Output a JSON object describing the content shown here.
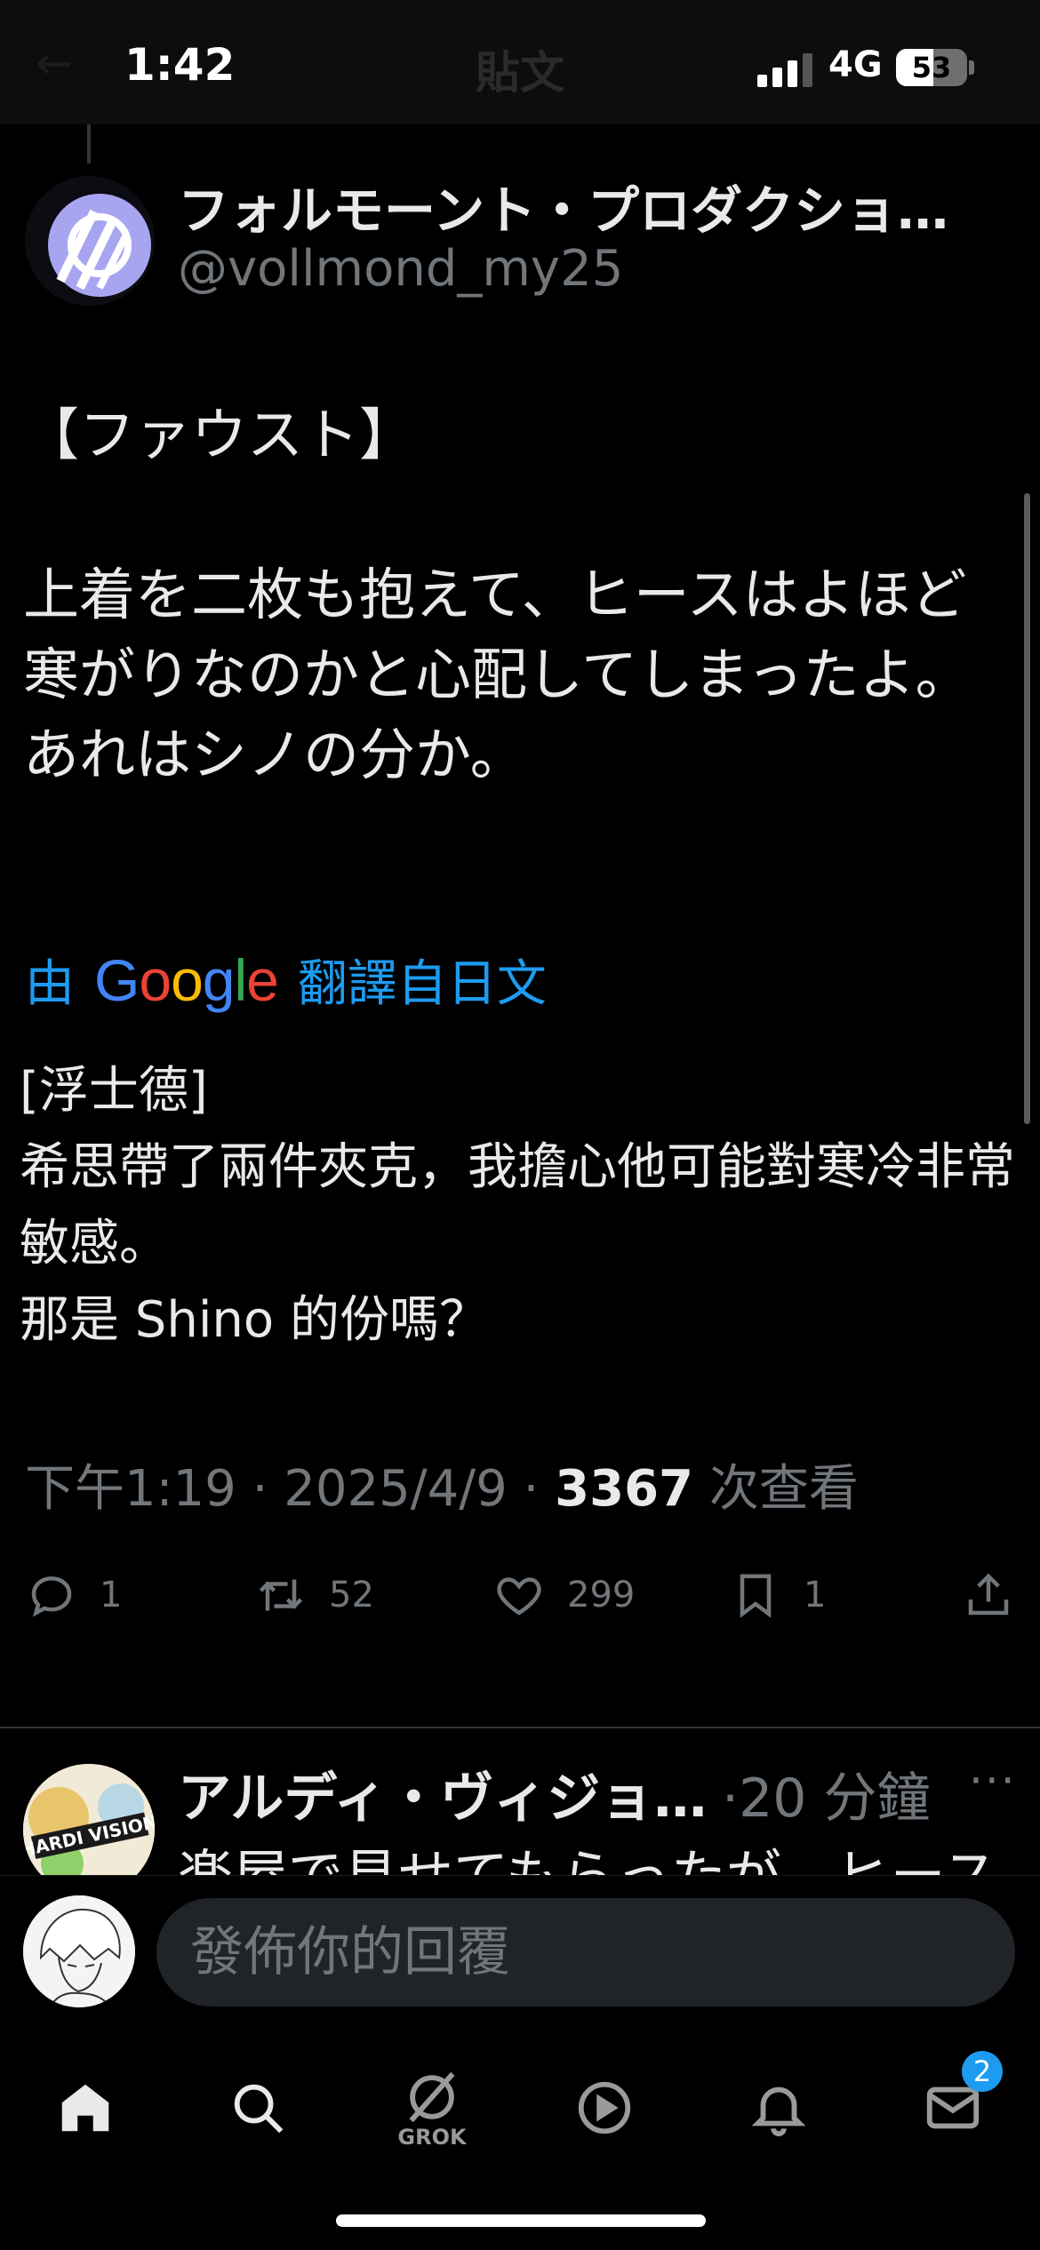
{
  "status_bar": {
    "time": "1:42",
    "network": "4G",
    "battery": "53",
    "battery_level": 0.53
  },
  "header": {
    "title": "貼文"
  },
  "tweet": {
    "author_name": "フォルモーント・プロダクショ…",
    "author_handle": "@vollmond_my25",
    "text": "【ファウスト】\n\n上着を二枚も抱えて、ヒースはよほど寒がりなのかと心配してしまったよ。\nあれはシノの分か。",
    "translate_prefix": "由",
    "translate_brand": "Google",
    "translate_suffix": "翻譯自日文",
    "translated_text": "[浮士德]\n希思帶了兩件夾克，我擔心他可能對寒冷非常敏感。\n那是 Shino 的份嗎？",
    "meta_time": "下午1:19",
    "meta_date": "2025/4/9",
    "meta_separator": "·",
    "views_count": "3367",
    "views_label": "次查看",
    "stats": {
      "replies": "1",
      "retweets": "52",
      "likes": "299",
      "bookmarks": "1"
    }
  },
  "reply_preview": {
    "author_name": "アルディ・ヴィジョ…",
    "time": "·20 分鐘",
    "more": "···",
    "text": "楽屋で見せてもらったが、ヒース",
    "avatar_text": "HARDI VISION"
  },
  "compose": {
    "placeholder": "發佈你的回覆"
  },
  "nav": {
    "items": [
      "home-icon",
      "search-icon",
      "grok-icon",
      "video-icon",
      "notifications-icon",
      "messages-icon"
    ],
    "grok_label": "GROK",
    "messages_badge": "2"
  },
  "colors": {
    "accent": "#1d9bf0",
    "text": "#e7e9ea",
    "muted": "#71767b",
    "background": "#000000"
  }
}
